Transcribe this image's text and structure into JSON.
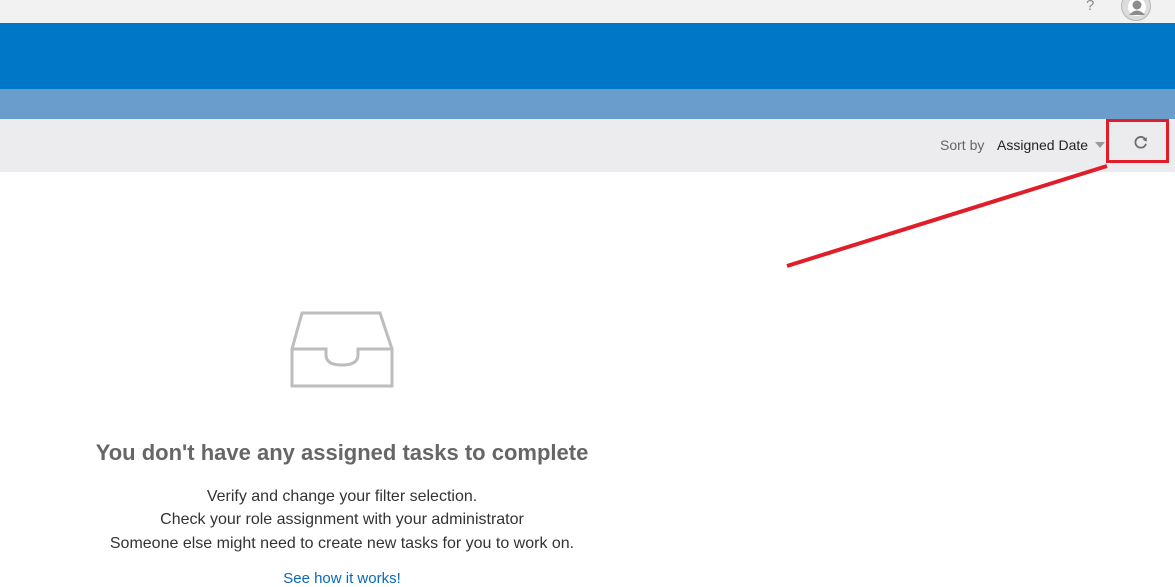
{
  "shell": {
    "help_glyph": "?",
    "help_icon": "help-icon",
    "avatar_icon": "user-avatar-icon",
    "colors": {
      "topbar": "#f2f2f2",
      "header": "#0078c7",
      "subheader": "#6a9ccc",
      "toolbar": "#ececee"
    }
  },
  "toolbar": {
    "sort_label": "Sort by",
    "sort_value": "Assigned Date",
    "sort_caret_icon": "caret-down-icon",
    "refresh_icon": "refresh-icon",
    "highlight_color": "#e01e2a"
  },
  "empty_state": {
    "icon": "inbox-tray-icon",
    "title": "You don't have any assigned tasks to complete",
    "hints": [
      "Verify and change your filter selection.",
      "Check your role assignment with your administrator",
      "Someone else might need to create new tasks for you to work on."
    ],
    "link": "See how it works!"
  }
}
